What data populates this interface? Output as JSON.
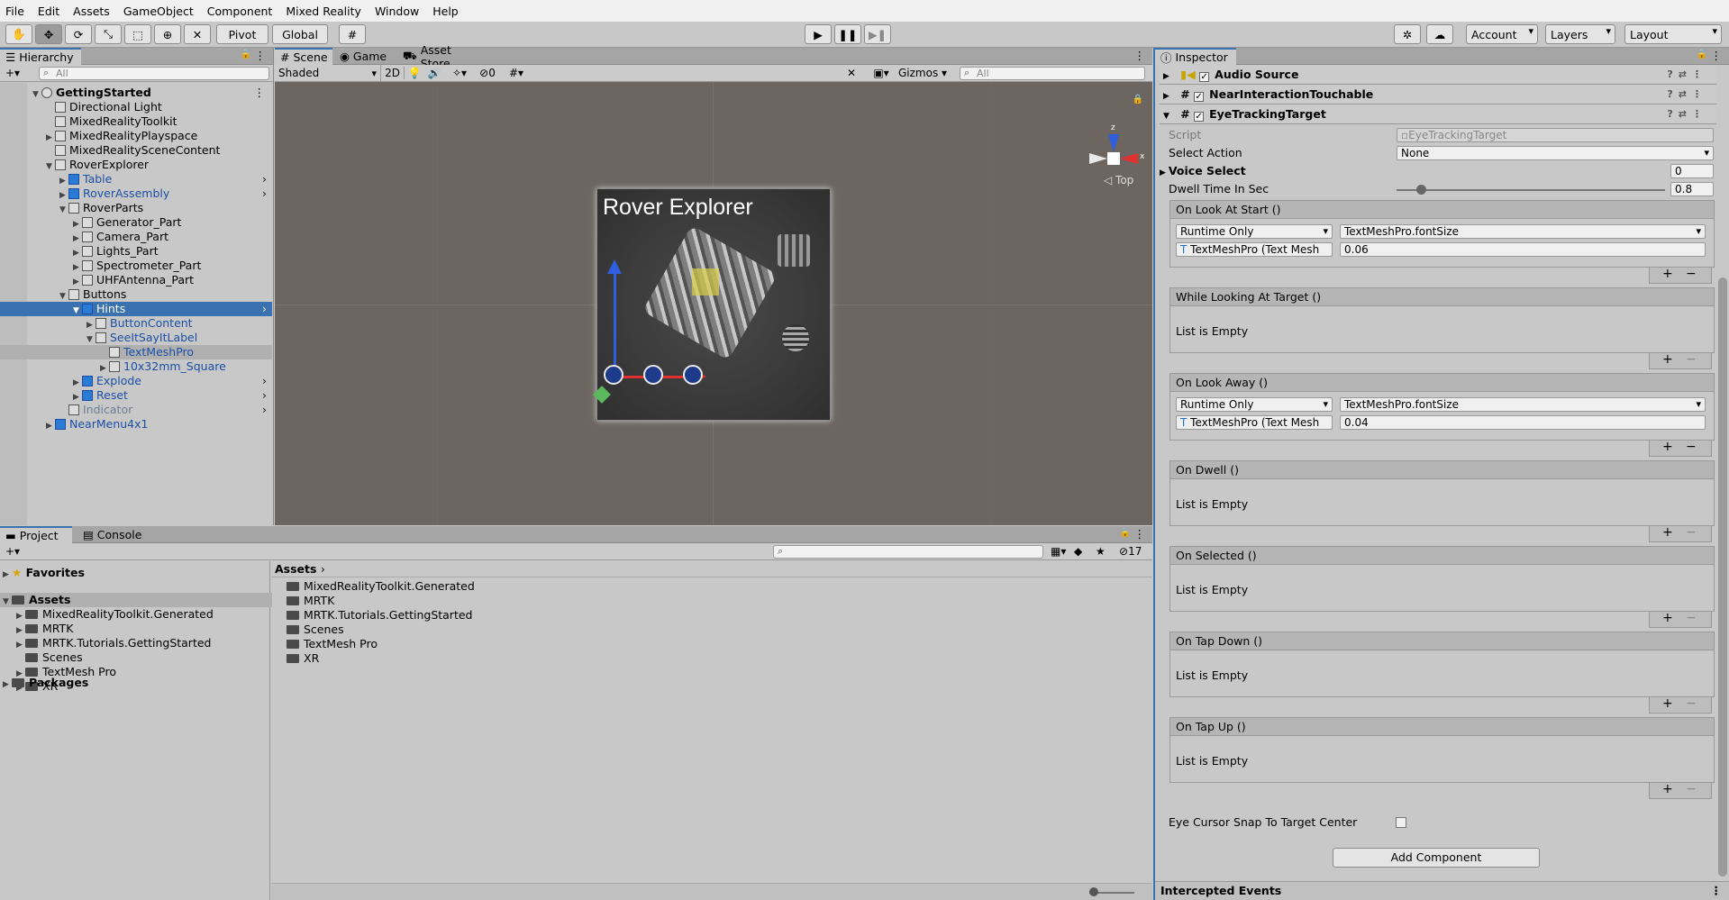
{
  "menu": [
    "File",
    "Edit",
    "Assets",
    "GameObject",
    "Component",
    "Mixed Reality",
    "Window",
    "Help"
  ],
  "toolbar": {
    "pivot": "Pivot",
    "global": "Global",
    "account": "Account",
    "layers": "Layers",
    "layout": "Layout"
  },
  "hierarchy": {
    "tab": "Hierarchy",
    "search_placeholder": "All",
    "rows": [
      {
        "label": "GettingStarted",
        "indent": 0
      },
      {
        "label": "Directional Light",
        "indent": 1
      },
      {
        "label": "MixedRealityToolkit",
        "indent": 1
      },
      {
        "label": "MixedRealityPlayspace",
        "indent": 1
      },
      {
        "label": "MixedRealitySceneContent",
        "indent": 1
      },
      {
        "label": "RoverExplorer",
        "indent": 1
      },
      {
        "label": "Table",
        "indent": 2
      },
      {
        "label": "RoverAssembly",
        "indent": 2
      },
      {
        "label": "RoverParts",
        "indent": 2
      },
      {
        "label": "Generator_Part",
        "indent": 3
      },
      {
        "label": "Camera_Part",
        "indent": 3
      },
      {
        "label": "Lights_Part",
        "indent": 3
      },
      {
        "label": "Spectrometer_Part",
        "indent": 3
      },
      {
        "label": "UHFAntenna_Part",
        "indent": 3
      },
      {
        "label": "Buttons",
        "indent": 2
      },
      {
        "label": "Hints",
        "indent": 3
      },
      {
        "label": "ButtonContent",
        "indent": 4
      },
      {
        "label": "SeeItSayItLabel",
        "indent": 4
      },
      {
        "label": "TextMeshPro",
        "indent": 5
      },
      {
        "label": "10x32mm_Square",
        "indent": 5
      },
      {
        "label": "Explode",
        "indent": 3
      },
      {
        "label": "Reset",
        "indent": 3
      },
      {
        "label": "Indicator",
        "indent": 2
      },
      {
        "label": "NearMenu4x1",
        "indent": 1
      }
    ]
  },
  "scene": {
    "tabs": [
      "Scene",
      "Game",
      "Asset Store"
    ],
    "shading": "Shaded",
    "mode2d": "2D",
    "hidden_count": "0",
    "gizmos": "Gizmos",
    "search_placeholder": "All",
    "view_label": "Top",
    "board_title": "Rover Explorer"
  },
  "inspector": {
    "tab": "Inspector",
    "components": [
      "Audio Source",
      "NearInteractionTouchable",
      "EyeTrackingTarget"
    ],
    "script_label": "Script",
    "script_value": "EyeTrackingTarget",
    "select_action_label": "Select Action",
    "select_action_value": "None",
    "voice_select_label": "Voice Select",
    "voice_select_value": "0",
    "dwell_label": "Dwell Time In Sec",
    "dwell_value": "0.8",
    "events": [
      {
        "title": "On Look At Start ()",
        "runtime": "Runtime Only",
        "func": "TextMeshPro.fontSize",
        "obj": "TextMeshPro (Text Mesh",
        "val": "0.06"
      },
      {
        "title": "While Looking At Target ()",
        "empty": "List is Empty"
      },
      {
        "title": "On Look Away ()",
        "runtime": "Runtime Only",
        "func": "TextMeshPro.fontSize",
        "obj": "TextMeshPro (Text Mesh",
        "val": "0.04"
      },
      {
        "title": "On Dwell ()",
        "empty": "List is Empty"
      },
      {
        "title": "On Selected ()",
        "empty": "List is Empty"
      },
      {
        "title": "On Tap Down ()",
        "empty": "List is Empty"
      },
      {
        "title": "On Tap Up ()",
        "empty": "List is Empty"
      }
    ],
    "snap_label": "Eye Cursor Snap To Target Center",
    "add_component": "Add Component",
    "intercepted": "Intercepted Events"
  },
  "project": {
    "tabs": [
      "Project",
      "Console"
    ],
    "hidden_count": "17",
    "favorites": "Favorites",
    "assets_root": "Assets",
    "tree": [
      "MixedRealityToolkit.Generated",
      "MRTK",
      "MRTK.Tutorials.GettingStarted",
      "Scenes",
      "TextMesh Pro",
      "XR"
    ],
    "packages": "Packages",
    "breadcrumb": "Assets",
    "folders": [
      "MixedRealityToolkit.Generated",
      "MRTK",
      "MRTK.Tutorials.GettingStarted",
      "Scenes",
      "TextMesh Pro",
      "XR"
    ]
  },
  "colors": {
    "selection": "#3a72b0",
    "scene_bg": "#6d6660",
    "panel": "#c2c2c2"
  }
}
